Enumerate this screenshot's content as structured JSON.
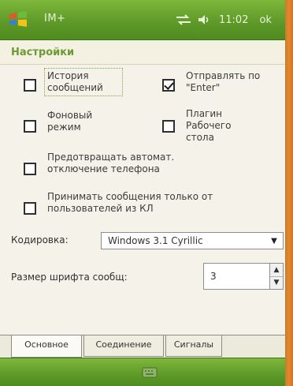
{
  "statusbar": {
    "app_name": "IM+",
    "time": "11:02",
    "ok_label": "ok",
    "icons": [
      "windows-start-icon",
      "connectivity-icon",
      "volume-icon"
    ]
  },
  "page": {
    "title": "Настройки"
  },
  "options": {
    "history": {
      "label": "История сообщений",
      "checked": false
    },
    "send_on_enter": {
      "label": "Отправлять по \"Enter\"",
      "checked": true
    },
    "background": {
      "label": "Фоновый режим",
      "checked": false
    },
    "desktop_plugin": {
      "label": "Плагин Рабочего стола",
      "checked": false
    },
    "prevent_autooff": {
      "label": "Предотвращать автомат. отключение телефона",
      "checked": false
    },
    "accept_only_cl": {
      "label": "Принимать сообщения только от пользователей из КЛ",
      "checked": false
    }
  },
  "encoding": {
    "label": "Кодировка:",
    "value": "Windows 3.1 Cyrillic"
  },
  "font_size": {
    "label": "Размер шрифта сообщ:",
    "value": "3"
  },
  "tabs": [
    {
      "label": "Основное",
      "active": true
    },
    {
      "label": "Соединение",
      "active": false
    },
    {
      "label": "Сигналы",
      "active": false
    }
  ],
  "colors": {
    "accent": "#6c9a34",
    "bar_green": "#5f9a2a",
    "background": "#f5f3e9"
  }
}
